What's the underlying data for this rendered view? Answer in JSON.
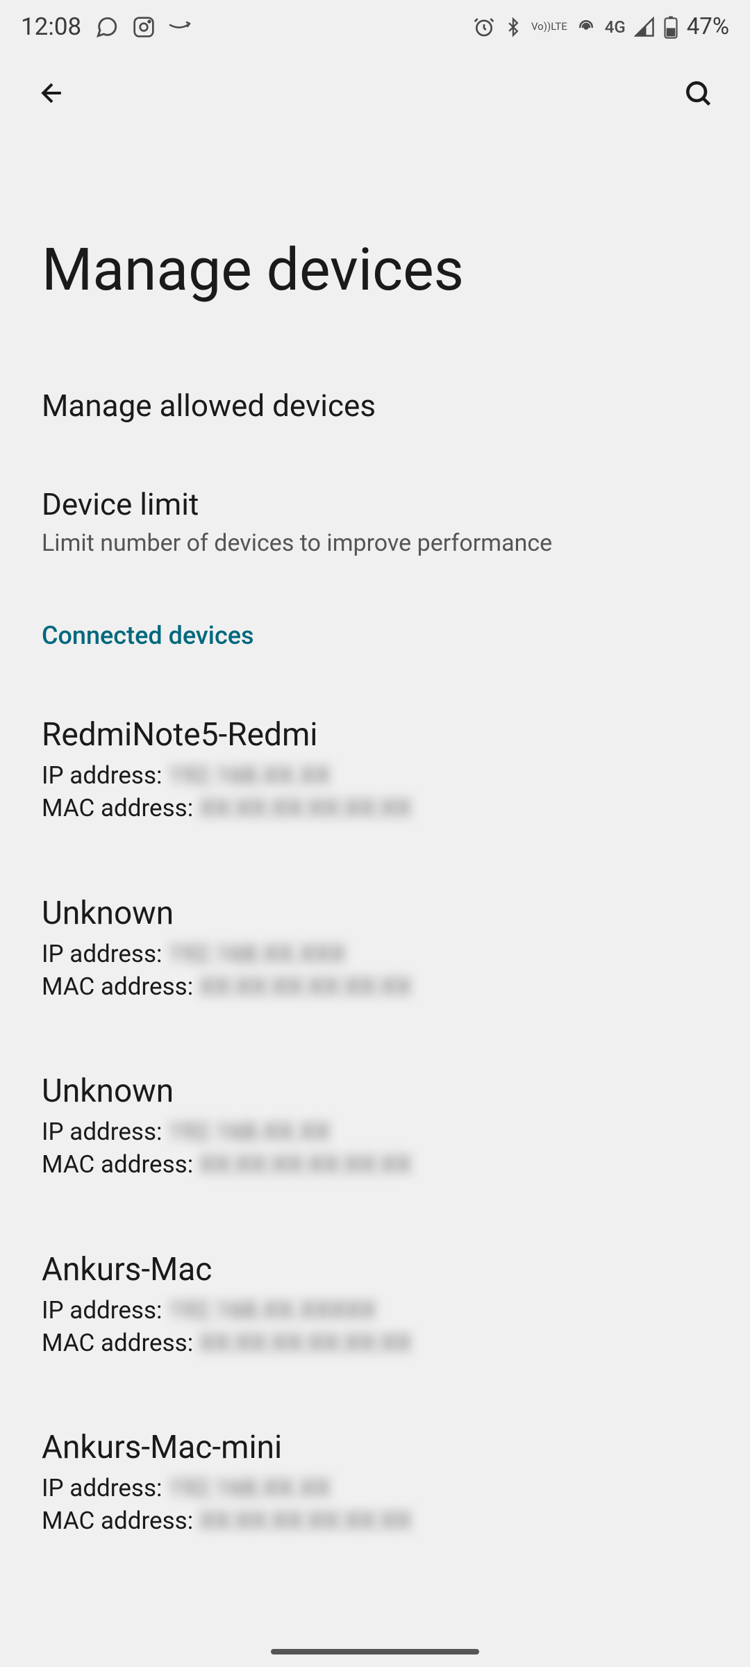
{
  "status_bar": {
    "time": "12:08",
    "battery": "47%",
    "network": "4G",
    "volte_top": "Vo))",
    "volte_bottom": "LTE"
  },
  "app_bar": {
    "back": "back",
    "search": "search"
  },
  "page_title": "Manage devices",
  "settings": [
    {
      "title": "Manage allowed devices",
      "subtitle": ""
    },
    {
      "title": "Device limit",
      "subtitle": "Limit number of devices to improve performance"
    }
  ],
  "section_header": "Connected devices",
  "ip_label": "IP address: ",
  "mac_label": "MAC address: ",
  "devices": [
    {
      "name": "RedmiNote5-Redmi",
      "ip": "192.168.XX.XX",
      "mac": "XX:XX:XX:XX:XX:XX"
    },
    {
      "name": "Unknown",
      "ip": "192.168.XX.XXX",
      "mac": "XX:XX:XX:XX:XX:XX"
    },
    {
      "name": "Unknown",
      "ip": "192.168.XX.XX",
      "mac": "XX:XX:XX:XX:XX:XX"
    },
    {
      "name": "Ankurs-Mac",
      "ip": "192.168.XX.XXXXX",
      "mac": "XX:XX:XX:XX:XX:XX"
    },
    {
      "name": "Ankurs-Mac-mini",
      "ip": "192.168.XX.XX",
      "mac": "XX:XX:XX:XX:XX:XX"
    }
  ]
}
